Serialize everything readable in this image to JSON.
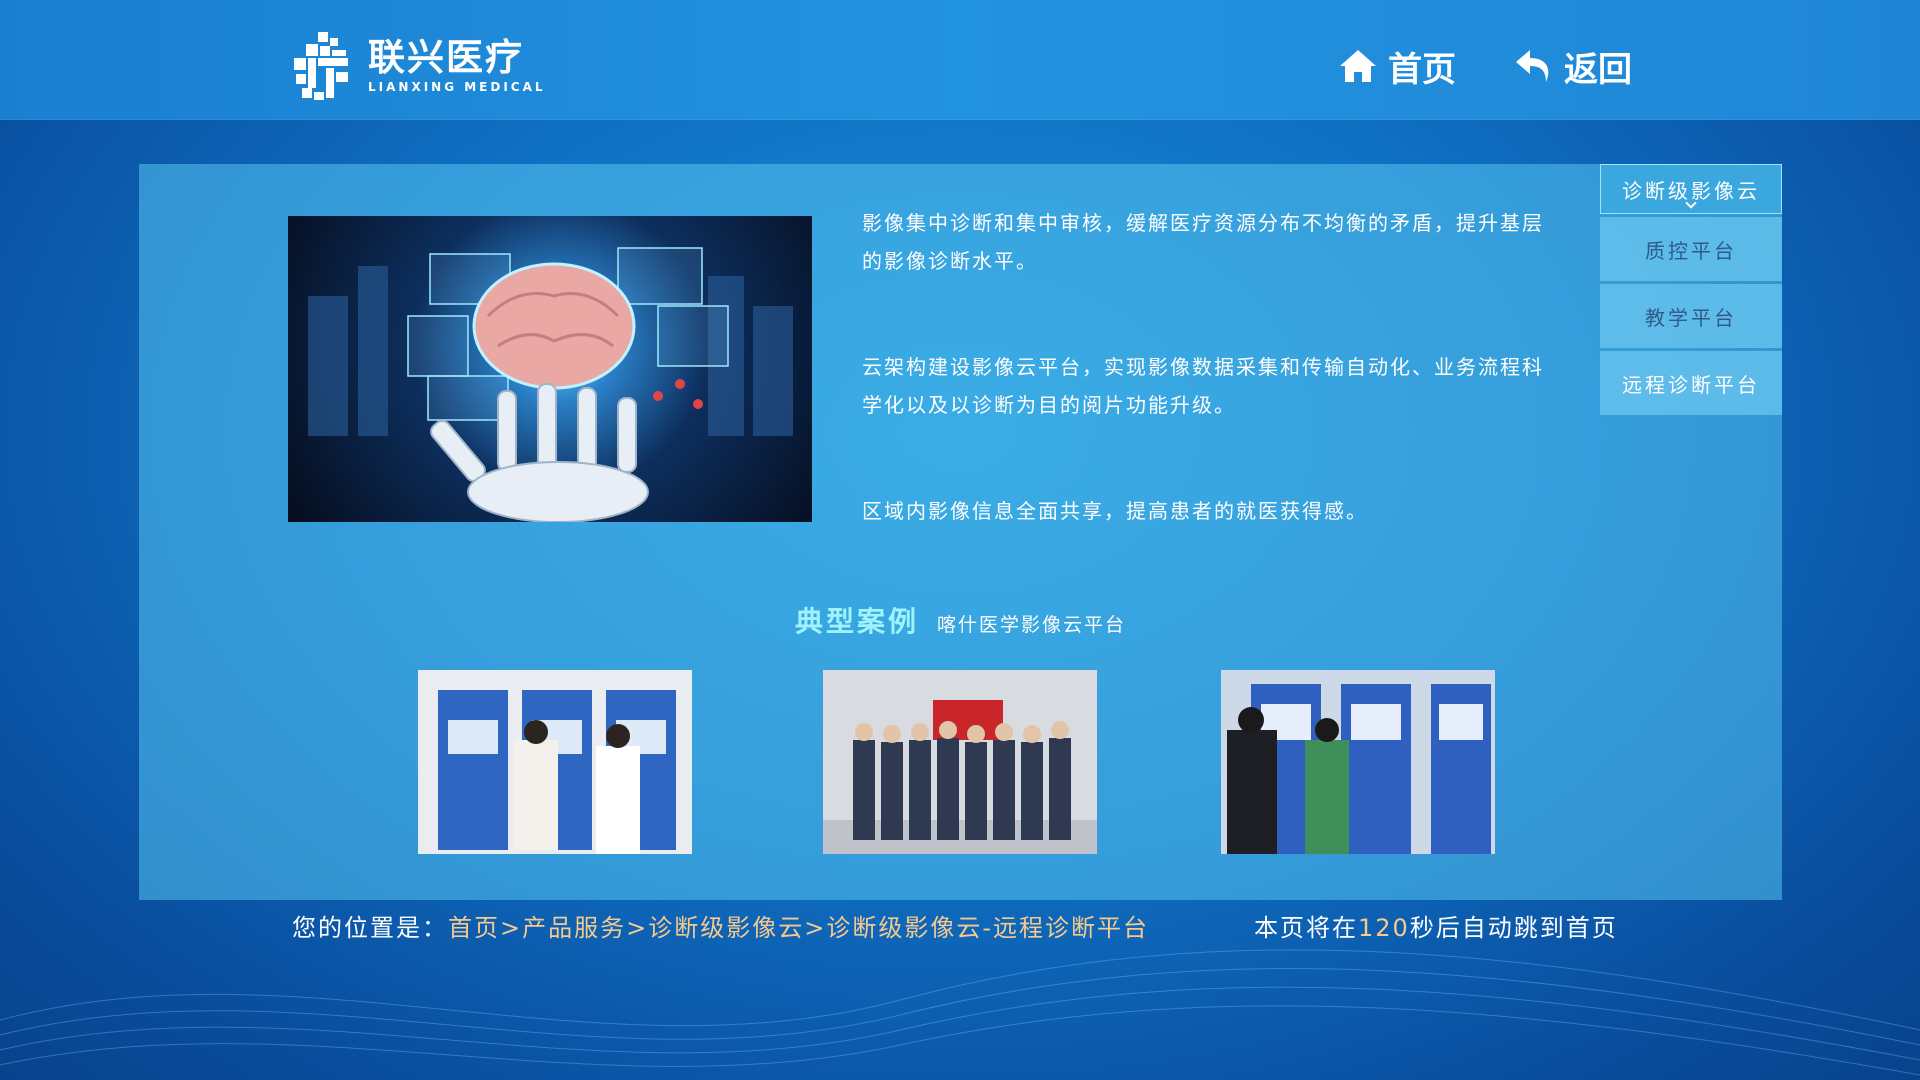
{
  "header": {
    "logo_cn": "联兴医疗",
    "logo_en": "LIANXING MEDICAL",
    "home_label": "首页",
    "back_label": "返回"
  },
  "content": {
    "desc1": "影像集中诊断和集中审核，缓解医疗资源分布不均衡的矛盾，提升基层的影像诊断水平。",
    "desc2": "云架构建设影像云平台，实现影像数据采集和传输自动化、业务流程科学化以及以诊断为目的阅片功能升级。",
    "desc3": "区域内影像信息全面共享，提高患者的就医获得感。",
    "case_title": "典型案例",
    "case_subtitle": "喀什医学影像云平台"
  },
  "side_menu": {
    "items": [
      {
        "label": "诊断级影像云",
        "active": true
      },
      {
        "label": "质控平台",
        "active": false
      },
      {
        "label": "教学平台",
        "active": false
      },
      {
        "label": "远程诊断平台",
        "active": false
      }
    ]
  },
  "footer": {
    "location_label": "您的位置是：",
    "breadcrumb": "首页>产品服务>诊断级影像云>诊断级影像云-远程诊断平台",
    "jump_prefix": "本页将在",
    "jump_seconds": "120",
    "jump_suffix": "秒后自动跳到首页"
  },
  "colors": {
    "accent": "#9ff3ff",
    "highlight": "#f6c98d",
    "background": "#0f6fc2"
  },
  "icons": {
    "home": "home-icon",
    "back": "back-arrow-icon"
  }
}
